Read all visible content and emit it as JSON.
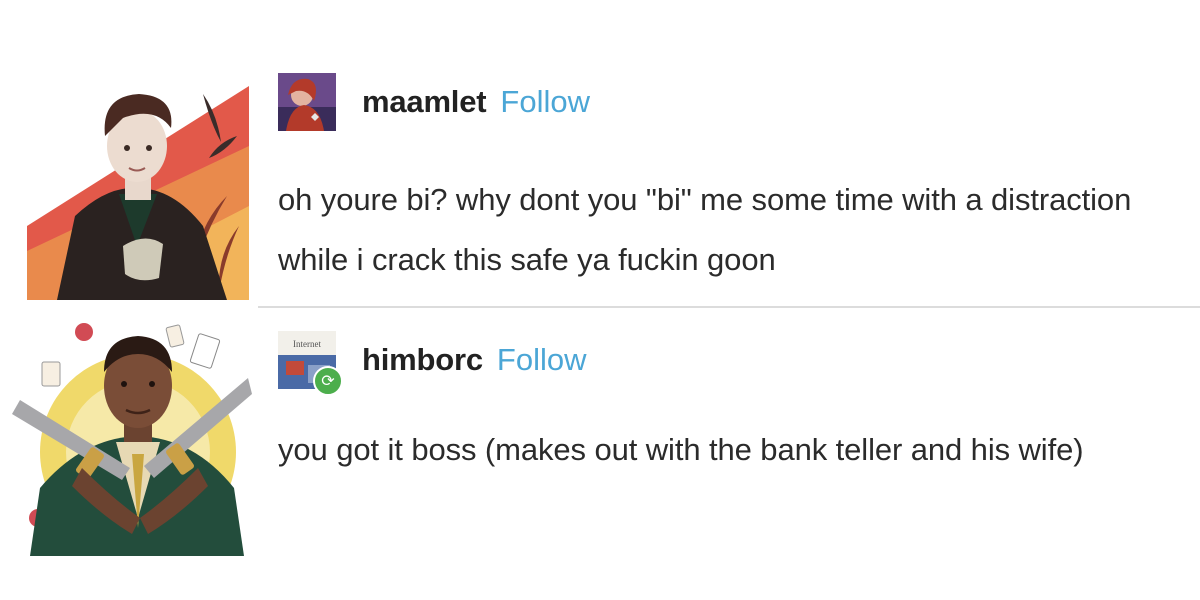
{
  "posts": [
    {
      "username": "maamlet",
      "follow_label": "Follow",
      "body": "oh youre bi? why dont you \"bi\" me some time with a distraction while i crack this safe ya fuckin goon"
    },
    {
      "username": "himborc",
      "follow_label": "Follow",
      "body": "you got it boss (makes out with the bank teller and his wife)",
      "avatar_label": "Internet",
      "reblog_icon": "reblog-icon"
    }
  ],
  "colors": {
    "follow": "#4ba6d6",
    "reblog_badge": "#4cae4c",
    "divider": "#dcdcdc"
  }
}
